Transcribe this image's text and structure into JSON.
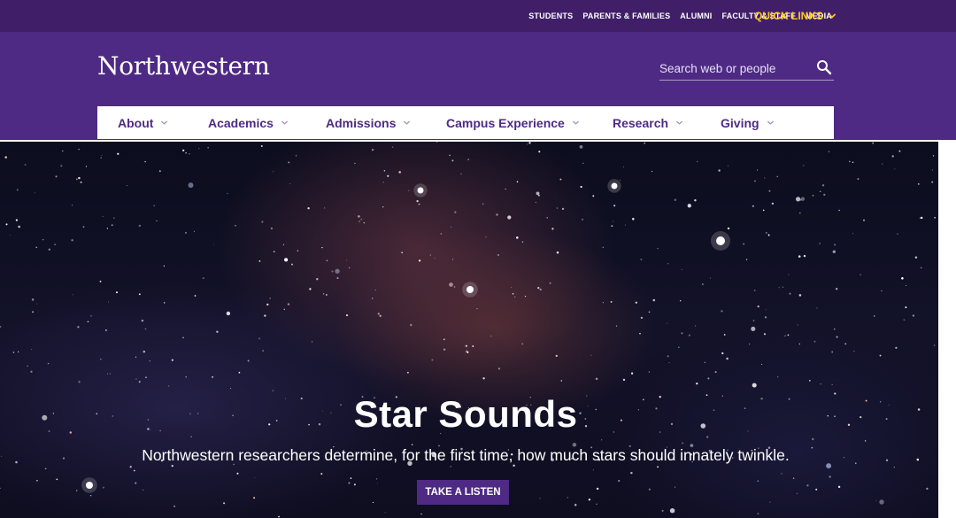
{
  "utility_bar": {
    "links": [
      "STUDENTS",
      "PARENTS & FAMILIES",
      "ALUMNI",
      "FACULTY & STAFF",
      "MEDIA"
    ],
    "quick_links": "QUICK LINKS"
  },
  "header": {
    "logo": "Northwestern",
    "search_placeholder": "Search web or people"
  },
  "nav": {
    "items": [
      "About",
      "Academics",
      "Admissions",
      "Campus Experience",
      "Research",
      "Giving"
    ]
  },
  "hero": {
    "title": "Star Sounds",
    "subtitle": "Northwestern researchers determine, for the first time, how much stars should innately twinkle.",
    "button": "TAKE A LISTEN"
  },
  "colors": {
    "brand_purple": "#4e2a84",
    "utility_purple": "#401f68",
    "quick_links_gold": "#ffc520"
  }
}
